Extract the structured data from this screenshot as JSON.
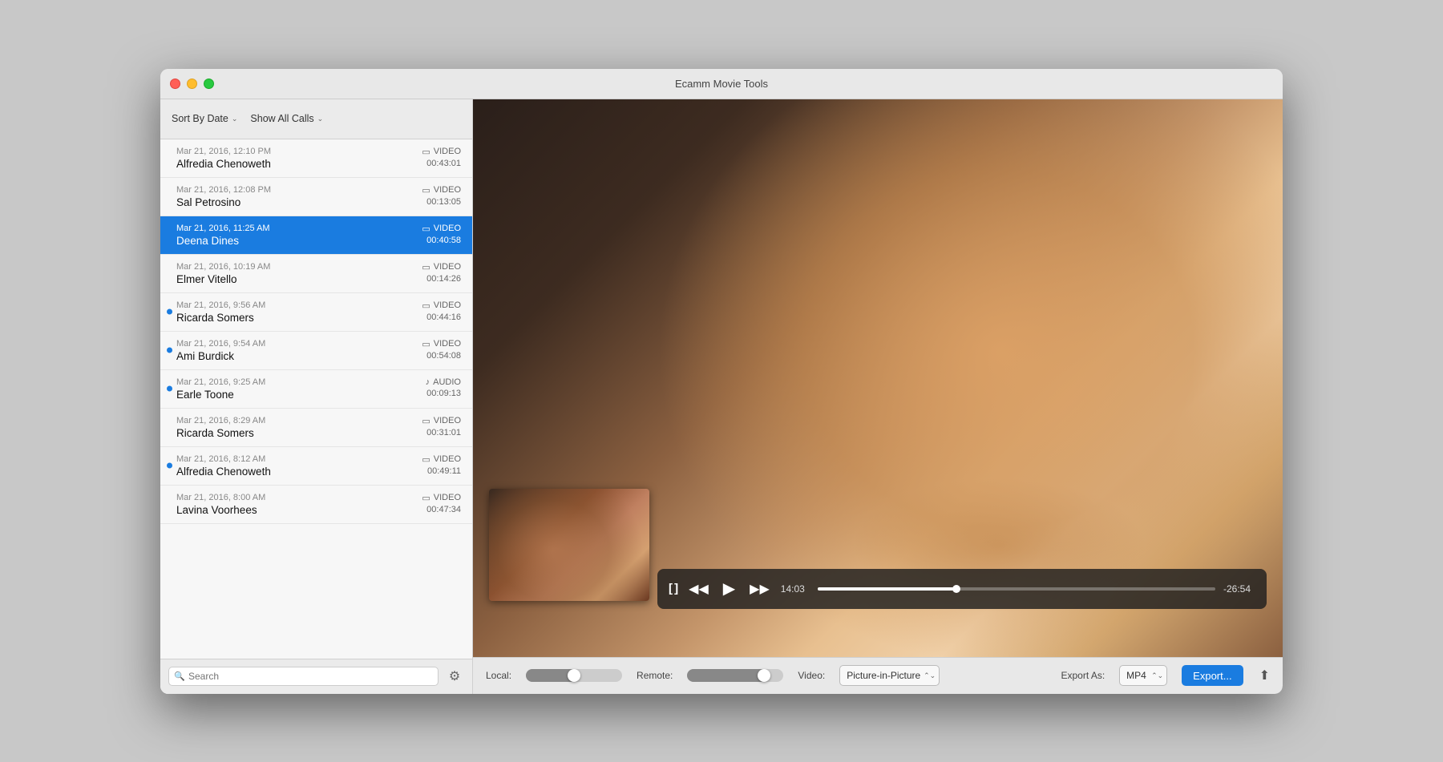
{
  "window": {
    "title": "Ecamm Movie Tools"
  },
  "sidebar": {
    "sort_label": "Sort By Date",
    "filter_label": "Show All Calls",
    "search_placeholder": "Search",
    "calls": [
      {
        "id": 1,
        "date": "Mar 21, 2016, 12:10 PM",
        "name": "Alfredia Chenoweth",
        "type": "VIDEO",
        "duration": "00:43:01",
        "has_dot": false,
        "active": false
      },
      {
        "id": 2,
        "date": "Mar 21, 2016, 12:08 PM",
        "name": "Sal Petrosino",
        "type": "VIDEO",
        "duration": "00:13:05",
        "has_dot": false,
        "active": false
      },
      {
        "id": 3,
        "date": "Mar 21, 2016, 11:25 AM",
        "name": "Deena Dines",
        "type": "VIDEO",
        "duration": "00:40:58",
        "has_dot": false,
        "active": true
      },
      {
        "id": 4,
        "date": "Mar 21, 2016, 10:19 AM",
        "name": "Elmer Vitello",
        "type": "VIDEO",
        "duration": "00:14:26",
        "has_dot": false,
        "active": false
      },
      {
        "id": 5,
        "date": "Mar 21, 2016, 9:56 AM",
        "name": "Ricarda Somers",
        "type": "VIDEO",
        "duration": "00:44:16",
        "has_dot": true,
        "active": false
      },
      {
        "id": 6,
        "date": "Mar 21, 2016, 9:54 AM",
        "name": "Ami Burdick",
        "type": "VIDEO",
        "duration": "00:54:08",
        "has_dot": true,
        "active": false
      },
      {
        "id": 7,
        "date": "Mar 21, 2016, 9:25 AM",
        "name": "Earle Toone",
        "type": "AUDIO",
        "duration": "00:09:13",
        "has_dot": true,
        "active": false
      },
      {
        "id": 8,
        "date": "Mar 21, 2016, 8:29 AM",
        "name": "Ricarda Somers",
        "type": "VIDEO",
        "duration": "00:31:01",
        "has_dot": false,
        "active": false
      },
      {
        "id": 9,
        "date": "Mar 21, 2016, 8:12 AM",
        "name": "Alfredia Chenoweth",
        "type": "VIDEO",
        "duration": "00:49:11",
        "has_dot": true,
        "active": false
      },
      {
        "id": 10,
        "date": "Mar 21, 2016, 8:00 AM",
        "name": "Lavina Voorhees",
        "type": "VIDEO",
        "duration": "00:47:34",
        "has_dot": false,
        "active": false
      }
    ]
  },
  "player": {
    "current_time": "14:03",
    "remaining_time": "-26:54",
    "progress_percent": 35
  },
  "bottom_toolbar": {
    "local_label": "Local:",
    "remote_label": "Remote:",
    "video_label": "Video:",
    "video_option": "Picture-in-Picture",
    "export_as_label": "Export As:",
    "export_format": "MP4",
    "export_btn_label": "Export..."
  }
}
